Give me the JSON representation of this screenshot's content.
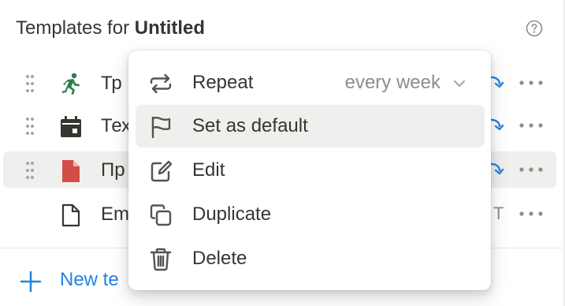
{
  "header": {
    "prefix": "Templates for ",
    "page_name": "Untitled"
  },
  "templates": [
    {
      "name": "Тр",
      "icon": "running-person-icon",
      "icon_color": "#2e7d4f"
    },
    {
      "name": "Тех",
      "icon": "calendar-icon",
      "icon_color": "#37352f"
    },
    {
      "name": "Пр",
      "icon": "document-icon",
      "icon_color": "#d44c47"
    },
    {
      "name": "Em",
      "icon": "blank-page-icon",
      "icon_color": "#37352f",
      "tag": "T"
    }
  ],
  "new_template": {
    "label": "New te"
  },
  "menu": {
    "repeat": {
      "label": "Repeat",
      "value": "every week"
    },
    "set_default": {
      "label": "Set as default"
    },
    "edit": {
      "label": "Edit"
    },
    "duplicate": {
      "label": "Duplicate"
    },
    "delete": {
      "label": "Delete"
    }
  },
  "colors": {
    "accent": "#2383e2",
    "text": "#37352f",
    "muted": "#8f8d88",
    "hover": "#efefee"
  }
}
